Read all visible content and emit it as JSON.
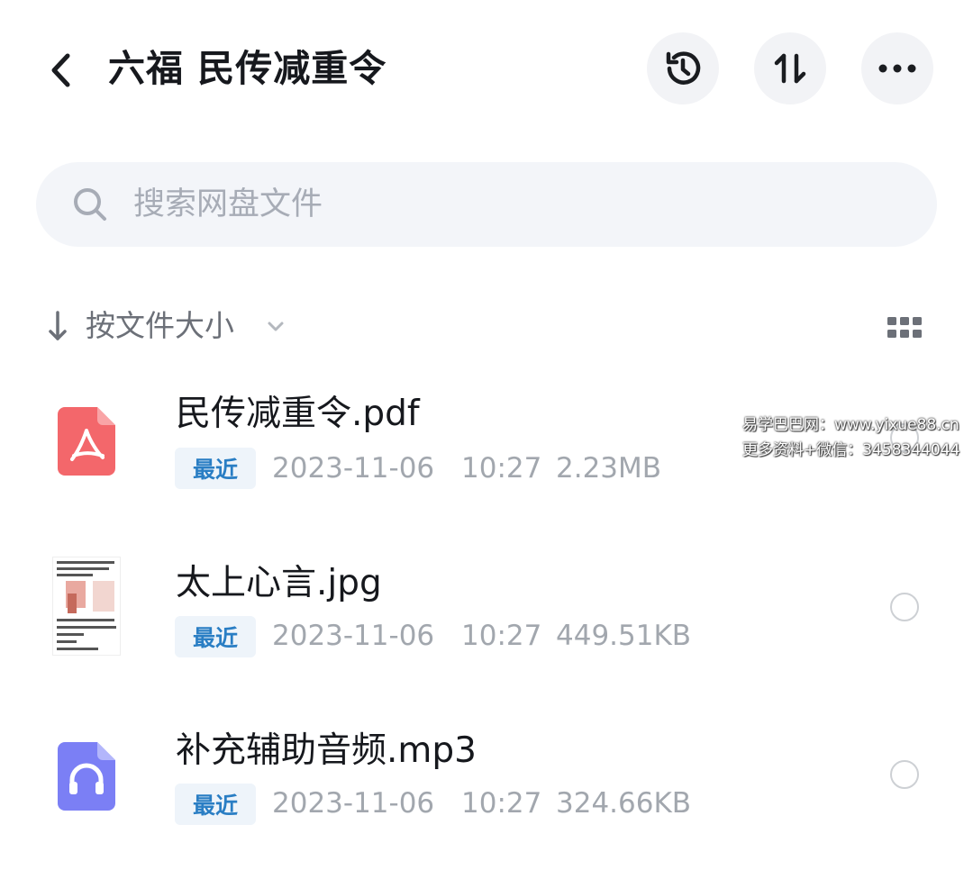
{
  "header": {
    "title": "六福 民传减重令",
    "back_icon": "chevron-left-icon",
    "history_icon": "history-icon",
    "sort_icon": "sort-arrows-icon",
    "more_icon": "more-icon"
  },
  "search": {
    "placeholder": "搜索网盘文件"
  },
  "sort_bar": {
    "label": "按文件大小",
    "arrow_icon": "arrow-down-icon",
    "dropdown_icon": "chevron-down-icon",
    "view_icon": "grid-view-icon"
  },
  "files": [
    {
      "name": "民传减重令.pdf",
      "badge": "最近",
      "date": "2023-11-06",
      "time": "10:27",
      "size": "2.23MB",
      "icon": "pdf-icon",
      "icon_color": "#f3676b"
    },
    {
      "name": "太上心言.jpg",
      "badge": "最近",
      "date": "2023-11-06",
      "time": "10:27",
      "size": "449.51KB",
      "icon": "image-thumbnail"
    },
    {
      "name": "补充辅助音频.mp3",
      "badge": "最近",
      "date": "2023-11-06",
      "time": "10:27",
      "size": "324.66KB",
      "icon": "audio-icon",
      "icon_color": "#7b7ff5"
    }
  ],
  "watermark": {
    "line1": "易学巴巴网：www.yixue88.cn",
    "line2": "更多资料+微信：3458344044"
  },
  "colors": {
    "badge_text": "#2a7ec4",
    "badge_bg": "#eef4fa",
    "meta_text": "#a2a7ae",
    "search_bg": "#f3f5f9"
  }
}
